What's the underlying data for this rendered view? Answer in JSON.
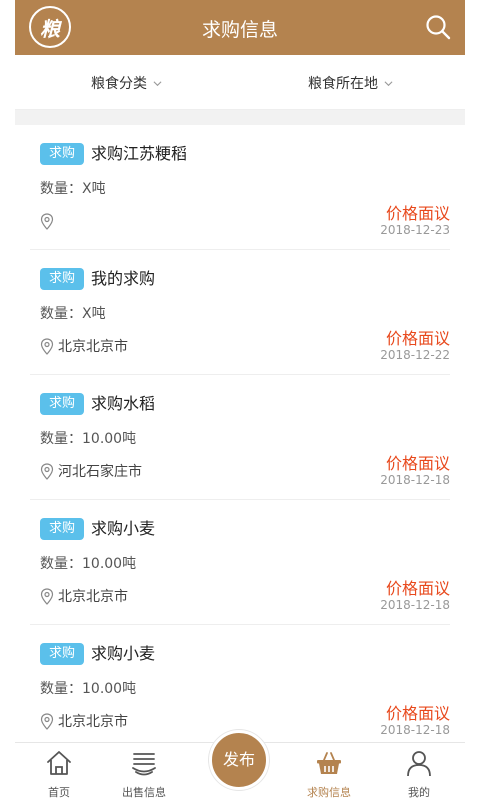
{
  "header": {
    "logo_text": "粮",
    "title": "求购信息"
  },
  "filters": {
    "category": "粮食分类",
    "location": "粮食所在地"
  },
  "items": [
    {
      "badge": "求购",
      "title": "求购江苏粳稻",
      "qty": "数量：X吨",
      "location": "",
      "price": "价格面议",
      "date": "2018-12-23"
    },
    {
      "badge": "求购",
      "title": "我的求购",
      "qty": "数量：X吨",
      "location": "北京北京市",
      "price": "价格面议",
      "date": "2018-12-22"
    },
    {
      "badge": "求购",
      "title": "求购水稻",
      "qty": "数量：10.00吨",
      "location": "河北石家庄市",
      "price": "价格面议",
      "date": "2018-12-18"
    },
    {
      "badge": "求购",
      "title": "求购小麦",
      "qty": "数量：10.00吨",
      "location": "北京北京市",
      "price": "价格面议",
      "date": "2018-12-18"
    },
    {
      "badge": "求购",
      "title": "求购小麦",
      "qty": "数量：10.00吨",
      "location": "北京北京市",
      "price": "价格面议",
      "date": "2018-12-18"
    }
  ],
  "tabbar": {
    "home": "首页",
    "sell": "出售信息",
    "publish": "发布",
    "buy": "求购信息",
    "mine": "我的"
  },
  "colors": {
    "brand": "#b4834f",
    "badge": "#5bc0eb",
    "price": "#e8491d"
  }
}
